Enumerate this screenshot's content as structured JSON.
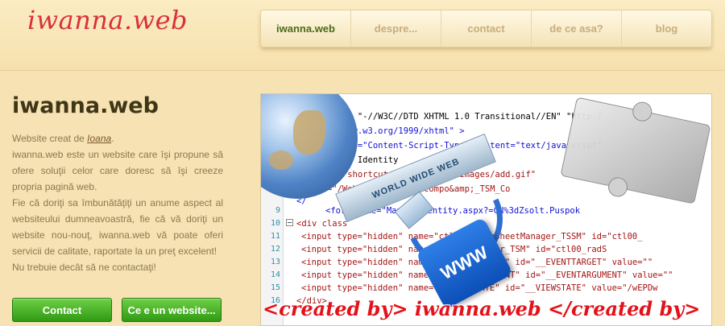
{
  "header": {
    "logo": "iwanna.web",
    "nav": [
      {
        "label": "iwanna.web",
        "active": true
      },
      {
        "label": "despre...",
        "active": false
      },
      {
        "label": "contact",
        "active": false
      },
      {
        "label": "de ce asa?",
        "active": false
      },
      {
        "label": "blog",
        "active": false
      }
    ]
  },
  "left": {
    "title": "iwanna.web",
    "created_prefix": "Website creat de ",
    "creator": "Ioana",
    "created_suffix": ".",
    "paragraph1": "iwanna.web este un website care îşi propune să ofere soluţii celor care doresc să îşi creeze propria pagină web.",
    "paragraph2": "Fie că doriţi sa îmbunătăţiţi un anume aspect al websiteului dumneavoastră, fie că vă doriţi un website nou-nouţ, iwanna.web vă poate oferi servicii de calitate, raportate la un preţ excelent!",
    "paragraph3": "Nu trebuie decât să ne contactaţi!",
    "buttons": {
      "contact": "Contact",
      "what": "Ce e un website..."
    }
  },
  "hero": {
    "code_lines": [
      {
        "num": "",
        "text": "html PUBLIC \"-//W3C//DTD XHTML 1.0 Transitional//EN\" \"http:/"
      },
      {
        "num": "",
        "text": "=\"http://www.w3.org/1999/xhtml\" >"
      },
      {
        "num": "",
        "text": "a http-equiv=\"Content-Script-Type\" content=\"text/javascript\""
      },
      {
        "num": "",
        "text": ": Manage an Identity"
      },
      {
        "num": "",
        "text": "link rel=\"shortcut icon\" href=\"/images/add.gif\" "
      },
      {
        "num": "",
        "text": "k href=\"/WebResource.axd?compo&amp;_TSM_Co"
      },
      {
        "num": "",
        "text": "</"
      },
      {
        "num": "9",
        "text": "<form name=\"ManageIdentity.aspx?=CN%3dZsolt.Puspok"
      },
      {
        "num": "10",
        "text": "<div class"
      },
      {
        "num": "11",
        "text": "<input type=\"hidden\" name=\"ctl00_StyleSheetManager_TSSM\" id=\"ctl00_"
      },
      {
        "num": "12",
        "text": "<input type=\"hidden\" name=\"ScriptManager_TSM\" id=\"ctl00_radS"
      },
      {
        "num": "13",
        "text": "<input type=\"hidden\" name=\"__EVENTTARGET\" id=\"__EVENTTARGET\" value=\"\" "
      },
      {
        "num": "14",
        "text": "<input type=\"hidden\" name=\"__EVENTARGUMENT\" id=\"__EVENTARGUMENT\" value=\"\""
      },
      {
        "num": "15",
        "text": "<input type=\"hidden\" name=\"__VIEWSTATE\" id=\"__VIEWSTATE\" value=\"/wEPDw"
      },
      {
        "num": "16",
        "text": "</div>"
      }
    ],
    "www_card": "WORLD WIDE WEB",
    "puzzle_label": "WWW",
    "watermark": "<created by> iwanna.web </created by>"
  }
}
